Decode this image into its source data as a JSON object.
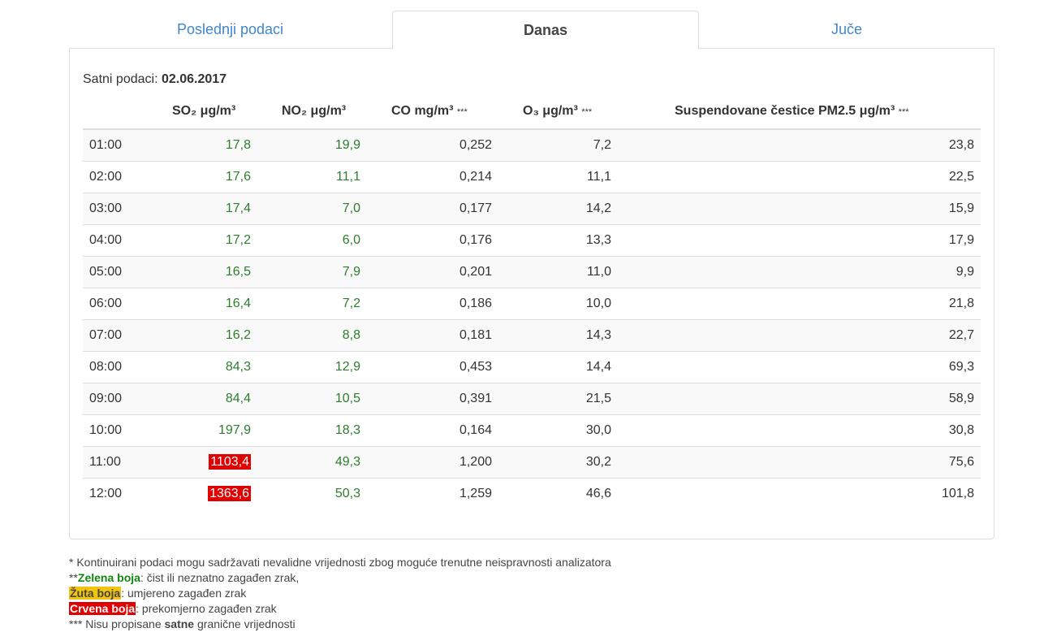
{
  "tabs": [
    {
      "label": "Poslednji podaci",
      "active": false
    },
    {
      "label": "Danas",
      "active": true
    },
    {
      "label": "Juče",
      "active": false
    }
  ],
  "subtitle": {
    "label": "Satni podaci: ",
    "date": "02.06.2017"
  },
  "table": {
    "headers": {
      "time": "",
      "so2": "SO₂ μg/m³",
      "no2": "NO₂ μg/m³",
      "co": "CO mg/m³",
      "co_note": "***",
      "o3": "O₃ μg/m³",
      "o3_note": "***",
      "pm25": "Suspendovane čestice PM2.5 μg/m³",
      "pm25_note": "***"
    },
    "rows": [
      {
        "time": "01:00",
        "so2": "17,8",
        "so2_level": "green",
        "no2": "19,9",
        "co": "0,252",
        "o3": "7,2",
        "pm25": "23,8"
      },
      {
        "time": "02:00",
        "so2": "17,6",
        "so2_level": "green",
        "no2": "11,1",
        "co": "0,214",
        "o3": "11,1",
        "pm25": "22,5"
      },
      {
        "time": "03:00",
        "so2": "17,4",
        "so2_level": "green",
        "no2": "7,0",
        "co": "0,177",
        "o3": "14,2",
        "pm25": "15,9"
      },
      {
        "time": "04:00",
        "so2": "17,2",
        "so2_level": "green",
        "no2": "6,0",
        "co": "0,176",
        "o3": "13,3",
        "pm25": "17,9"
      },
      {
        "time": "05:00",
        "so2": "16,5",
        "so2_level": "green",
        "no2": "7,9",
        "co": "0,201",
        "o3": "11,0",
        "pm25": "9,9"
      },
      {
        "time": "06:00",
        "so2": "16,4",
        "so2_level": "green",
        "no2": "7,2",
        "co": "0,186",
        "o3": "10,0",
        "pm25": "21,8"
      },
      {
        "time": "07:00",
        "so2": "16,2",
        "so2_level": "green",
        "no2": "8,8",
        "co": "0,181",
        "o3": "14,3",
        "pm25": "22,7"
      },
      {
        "time": "08:00",
        "so2": "84,3",
        "so2_level": "green",
        "no2": "12,9",
        "co": "0,453",
        "o3": "14,4",
        "pm25": "69,3"
      },
      {
        "time": "09:00",
        "so2": "84,4",
        "so2_level": "green",
        "no2": "10,5",
        "co": "0,391",
        "o3": "21,5",
        "pm25": "58,9"
      },
      {
        "time": "10:00",
        "so2": "197,9",
        "so2_level": "green",
        "no2": "18,3",
        "co": "0,164",
        "o3": "30,0",
        "pm25": "30,8"
      },
      {
        "time": "11:00",
        "so2": "1103,4",
        "so2_level": "red",
        "no2": "49,3",
        "co": "1,200",
        "o3": "30,2",
        "pm25": "75,6"
      },
      {
        "time": "12:00",
        "so2": "1363,6",
        "so2_level": "red",
        "no2": "50,3",
        "co": "1,259",
        "o3": "46,6",
        "pm25": "101,8"
      }
    ]
  },
  "notes": {
    "line1": "* Kontinuirani podaci mogu sadržavati nevalidne vrijednosti zbog moguće trenutne neispravnosti analizatora",
    "line2_prefix": "**",
    "green_label": "Zelena boja",
    "green_text": ": čist ili neznatno zagađen zrak,",
    "yellow_label": "Žuta boja",
    "yellow_text": ": umjereno zagađen zrak",
    "red_label": "Crvena boja",
    "red_text": ": prekomjerno zagađen zrak",
    "line5_prefix": "*** Nisu propisane ",
    "line5_bold": "satne",
    "line5_suffix": " granične vrijednosti"
  },
  "colors": {
    "link": "#3f87c7",
    "green": "#2d7d2d",
    "red": "#e00000",
    "yellow": "#f1c40f"
  }
}
